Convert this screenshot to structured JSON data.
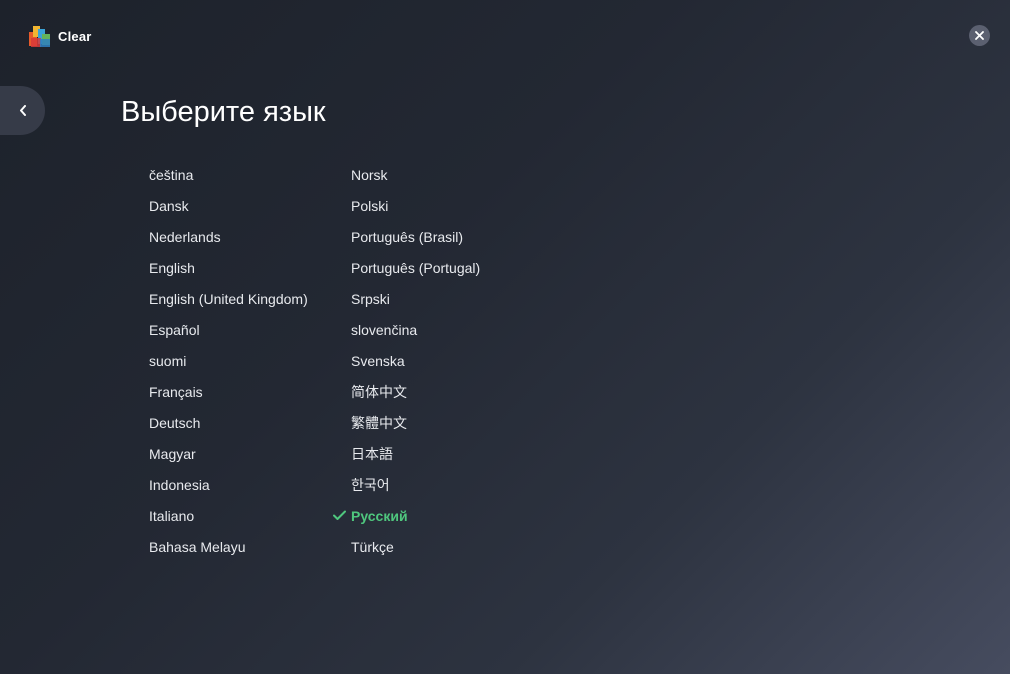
{
  "app": {
    "title": "Clear",
    "logo_icon": "avg-logo-icon",
    "close_icon": "close-icon",
    "back_icon": "chevron-left-icon"
  },
  "page": {
    "title": "Выберите язык"
  },
  "colors": {
    "background_dark": "#1d222b",
    "background_light": "#464c5f",
    "selected": "#4fc77e",
    "text": "#e8eaee"
  },
  "languages": {
    "column1": [
      {
        "label": "čeština",
        "selected": false
      },
      {
        "label": "Dansk",
        "selected": false
      },
      {
        "label": "Nederlands",
        "selected": false
      },
      {
        "label": "English",
        "selected": false
      },
      {
        "label": "English (United Kingdom)",
        "selected": false
      },
      {
        "label": "Español",
        "selected": false
      },
      {
        "label": "suomi",
        "selected": false
      },
      {
        "label": "Français",
        "selected": false
      },
      {
        "label": "Deutsch",
        "selected": false
      },
      {
        "label": "Magyar",
        "selected": false
      },
      {
        "label": "Indonesia",
        "selected": false
      },
      {
        "label": "Italiano",
        "selected": false
      },
      {
        "label": "Bahasa Melayu",
        "selected": false
      }
    ],
    "column2": [
      {
        "label": "Norsk",
        "selected": false
      },
      {
        "label": "Polski",
        "selected": false
      },
      {
        "label": "Português (Brasil)",
        "selected": false
      },
      {
        "label": "Português (Portugal)",
        "selected": false
      },
      {
        "label": "Srpski",
        "selected": false
      },
      {
        "label": "slovenčina",
        "selected": false
      },
      {
        "label": "Svenska",
        "selected": false
      },
      {
        "label": "简体中文",
        "selected": false
      },
      {
        "label": "繁體中文",
        "selected": false
      },
      {
        "label": "日本語",
        "selected": false
      },
      {
        "label": "한국어",
        "selected": false
      },
      {
        "label": "Русский",
        "selected": true
      },
      {
        "label": "Türkçe",
        "selected": false
      }
    ]
  }
}
